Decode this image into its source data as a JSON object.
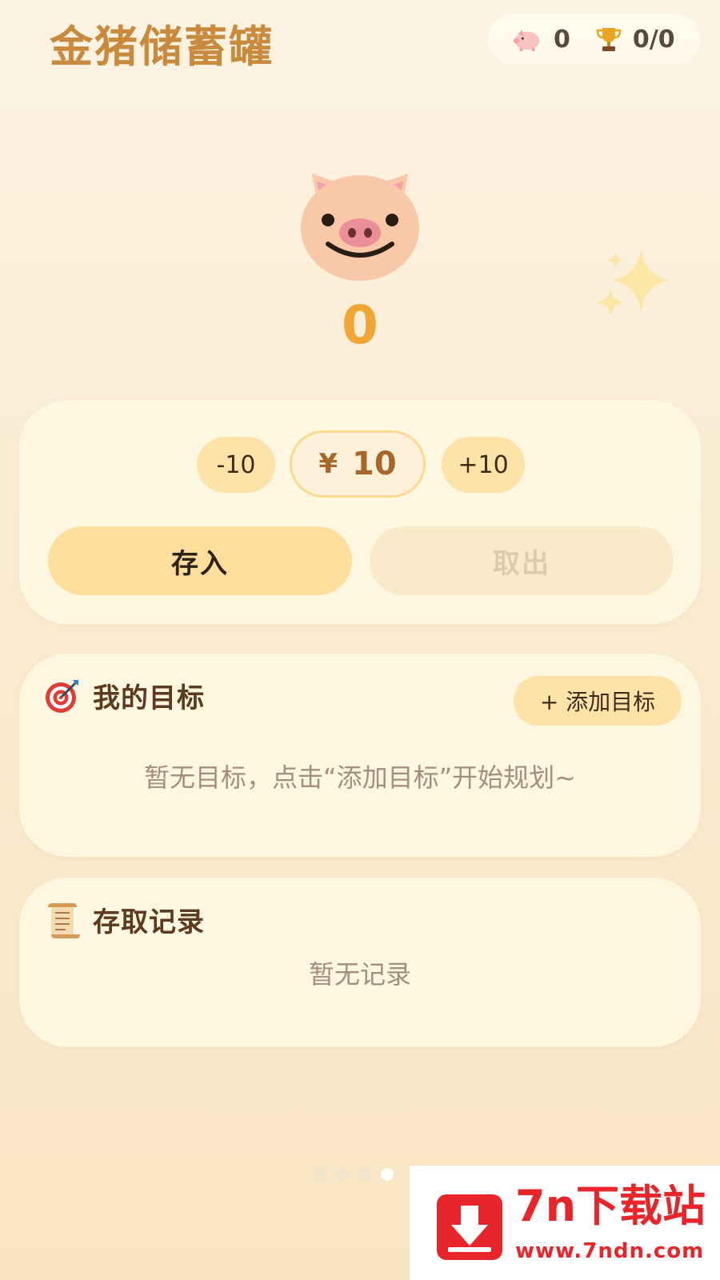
{
  "app": {
    "title": "金猪储蓄罐"
  },
  "stats": {
    "pig_count": "0",
    "trophy_progress": "0/0"
  },
  "balance": "0",
  "amount": {
    "minus_label": "-10",
    "currency": "¥",
    "value": "10",
    "plus_label": "+10"
  },
  "actions": {
    "deposit": "存入",
    "withdraw": "取出"
  },
  "goals": {
    "title": "我的目标",
    "add_label": "+ 添加目标",
    "empty": "暂无目标，点击“添加目标”开始规划~"
  },
  "records": {
    "title": "存取记录",
    "empty": "暂无记录"
  },
  "pager": {
    "count": 4,
    "active_index": 3
  },
  "watermark": {
    "title": "7n下载站",
    "url": "www.7ndn.com"
  },
  "colors": {
    "accent": "#f0a634",
    "title": "#c88a3c",
    "button": "#fde3a8",
    "card": "#fdf6e1"
  },
  "icons": {
    "stats_pig": "pig-icon",
    "stats_trophy": "trophy-icon",
    "hero": "pig-face-icon",
    "decor": "sparkles-icon",
    "goals": "target-icon",
    "records": "scroll-icon",
    "watermark": "download-arrow-icon"
  }
}
